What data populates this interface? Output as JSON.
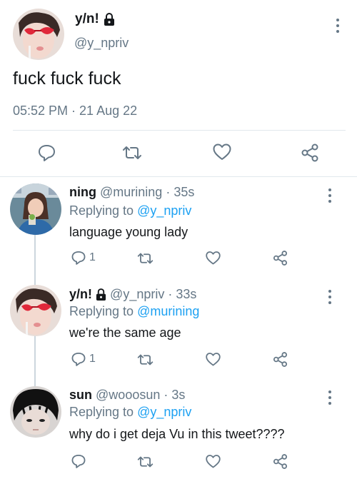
{
  "main_tweet": {
    "name": "y/n!",
    "handle": "@y_npriv",
    "text": "fuck fuck fuck",
    "timestamp": "05:52 PM · 21 Aug 22",
    "icons": [
      "reply-icon",
      "retweet-icon",
      "like-icon",
      "share-icon"
    ]
  },
  "replies": [
    {
      "name": "ning",
      "handle": "@murining",
      "time": "35s",
      "replying_label": "Replying to",
      "replying_to": "@y_npriv",
      "text": "language young lady",
      "reply_count": "1",
      "locked": false
    },
    {
      "name": "y/n!",
      "handle": "@y_npriv",
      "time": "33s",
      "replying_label": "Replying to",
      "replying_to": "@murining",
      "text": "we're the same age",
      "reply_count": "1",
      "locked": true
    },
    {
      "name": "sun",
      "handle": "@wooosun",
      "time": "3s",
      "replying_label": "Replying to",
      "replying_to": "@y_npriv",
      "text": "why do i get deja Vu in this tweet????",
      "reply_count": "",
      "locked": false
    }
  ],
  "separator": "·",
  "colors": {
    "text": "#14171a",
    "secondary": "#657786",
    "link": "#1da1f2",
    "divider": "#e1e8ed"
  }
}
